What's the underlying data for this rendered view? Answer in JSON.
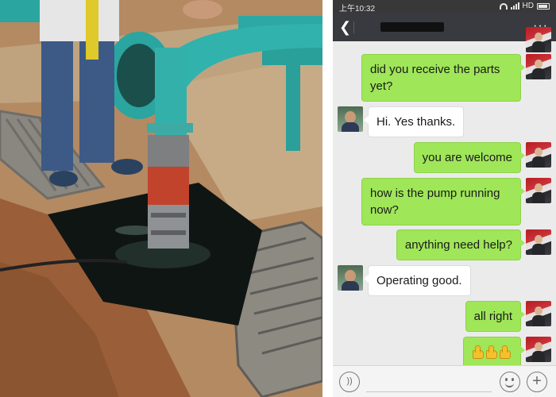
{
  "photo": {
    "icon": "photo-scene",
    "alt": ""
  },
  "status_bar": {
    "time": "上午10:32",
    "network": "HD"
  },
  "title_bar": {
    "back_icon": "chevron-left-icon",
    "contact_name": "",
    "more_label": "···"
  },
  "messages": [
    {
      "sender": "me",
      "text": "did you receive the parts yet?"
    },
    {
      "sender": "them",
      "text": "Hi. Yes thanks."
    },
    {
      "sender": "me",
      "text": "you are welcome"
    },
    {
      "sender": "me",
      "text": "how is the pump running now?"
    },
    {
      "sender": "me",
      "text": "anything need help?"
    },
    {
      "sender": "them",
      "text": "Operating good."
    },
    {
      "sender": "me",
      "text": "all right"
    },
    {
      "sender": "me",
      "text": "",
      "thumbs_up_count": 3
    }
  ],
  "input_bar": {
    "voice_icon": "voice-icon",
    "emoji_icon": "emoji-icon",
    "plus_label": "+"
  },
  "colors": {
    "my_bubble": "#9fe658",
    "their_bubble": "#ffffff",
    "chat_background": "#ebebeb",
    "title_bar": "#393a3f"
  }
}
